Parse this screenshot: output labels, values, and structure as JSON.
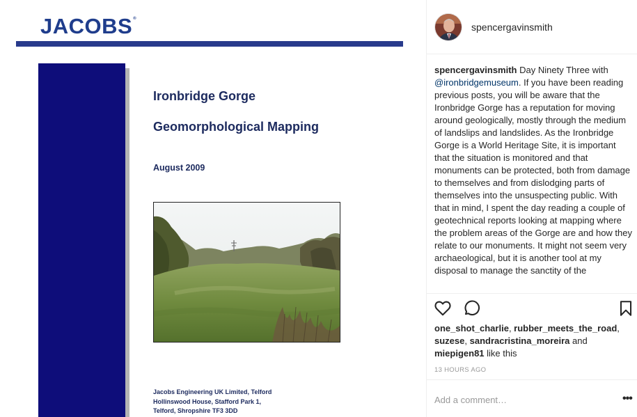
{
  "document": {
    "logo_text": "JACOBS",
    "logo_mark": "®",
    "title": "Ironbridge Gorge",
    "subtitle": "Geomorphological Mapping",
    "date": "August 2009",
    "address": [
      "Jacobs Engineering UK Limited, Telford",
      "Hollinswood House, Stafford Park 1,",
      "Telford, Shropshire TF3 3DD"
    ],
    "colors": {
      "brand": "#1f3d8c",
      "cover_band": "#0e0d7a",
      "title_text": "#1c2a5e"
    }
  },
  "post": {
    "header_username": "spencergavinsmith",
    "caption": {
      "username": "spencergavinsmith",
      "text_before_mention": " Day Ninety Three with ",
      "mention": "@ironbridgemuseum",
      "text_after_mention": ". If you have been reading previous posts, you will be aware that the Ironbridge Gorge has a reputation for moving around geologically, mostly through the medium of landslips and landslides. As the Ironbridge Gorge is a World Heritage Site, it is important that the situation is monitored and that monuments can be protected, both from damage to themselves and from dislodging parts of themselves into the unsuspecting public. With that in mind, I spent the day reading a couple of geotechnical reports looking at mapping where the problem areas of the Gorge are and how they relate to our monuments. It might not seem very archaeological, but it is another tool at my disposal to manage the sanctity of the"
    },
    "actions": {
      "like_icon": "heart-icon",
      "comment_icon": "comment-icon",
      "save_icon": "bookmark-icon"
    },
    "likes": {
      "user1": "one_shot_charlie",
      "sep1": ", ",
      "user2": "rubber_meets_the_road",
      "sep2": ", ",
      "user3": "suzese",
      "sep3": ", ",
      "user4": "sandracristina_moreira",
      "and": " and ",
      "user5": "miepigen81",
      "suffix": " like this"
    },
    "timestamp": "13 HOURS AGO",
    "comment": {
      "placeholder": "Add a comment…",
      "more_label": "•••"
    }
  }
}
